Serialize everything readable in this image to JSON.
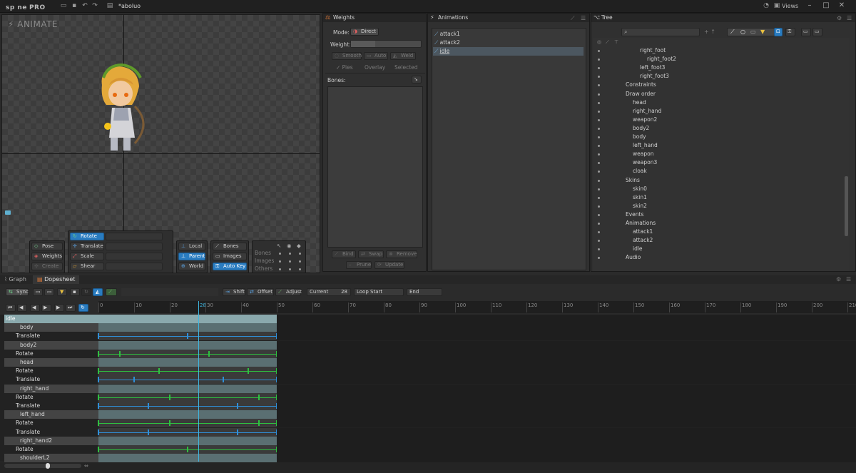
{
  "app": {
    "logo": "sp ne",
    "edition": "PRO",
    "project": "*aboluo",
    "views": "Views"
  },
  "viewport": {
    "mode_label": "ANIMATE"
  },
  "tools": {
    "pose": "Pose",
    "weights": "Weights",
    "create": "Create",
    "rotate": "Rotate",
    "translate": "Translate",
    "scale": "Scale",
    "shear": "Shear",
    "local": "Local",
    "parent": "Parent",
    "world": "World",
    "bones": "Bones",
    "images": "Images",
    "auto_key": "Auto Key",
    "vis_bones": "Bones",
    "vis_images": "Images",
    "vis_others": "Others"
  },
  "weights": {
    "title": "Weights",
    "mode_label": "Mode:",
    "mode_value": "Direct",
    "weight_label": "Weight:",
    "smooth": "Smooth",
    "auto": "Auto",
    "weld": "Weld",
    "pies": "Pies",
    "overlay": "Overlay",
    "selected": "Selected",
    "bones_label": "Bones:",
    "bind": "Bind",
    "swap": "Swap",
    "remove": "Remove",
    "prune": "Prune",
    "update": "Update"
  },
  "animations": {
    "title": "Animations",
    "items": [
      "attack1",
      "attack2",
      "idle"
    ]
  },
  "tree": {
    "title": "Tree",
    "rows": [
      {
        "label": "right_foot",
        "indent": 3
      },
      {
        "label": "right_foot2",
        "indent": 4
      },
      {
        "label": "left_foot3",
        "indent": 3
      },
      {
        "label": "right_foot3",
        "indent": 3
      },
      {
        "label": "Constraints",
        "indent": 1
      },
      {
        "label": "Draw order",
        "indent": 1
      },
      {
        "label": "head",
        "indent": 2
      },
      {
        "label": "right_hand",
        "indent": 2
      },
      {
        "label": "weapon2",
        "indent": 2
      },
      {
        "label": "body2",
        "indent": 2
      },
      {
        "label": "body",
        "indent": 2
      },
      {
        "label": "left_hand",
        "indent": 2
      },
      {
        "label": "weapon",
        "indent": 2
      },
      {
        "label": "weapon3",
        "indent": 2
      },
      {
        "label": "cloak",
        "indent": 2
      },
      {
        "label": "Skins",
        "indent": 1
      },
      {
        "label": "skin0",
        "indent": 2
      },
      {
        "label": "skin1",
        "indent": 2
      },
      {
        "label": "skin2",
        "indent": 2
      },
      {
        "label": "Events",
        "indent": 1
      },
      {
        "label": "Animations",
        "indent": 1
      },
      {
        "label": "attack1",
        "indent": 2
      },
      {
        "label": "attack2",
        "indent": 2
      },
      {
        "label": "idle",
        "indent": 2
      },
      {
        "label": "Audio",
        "indent": 1
      }
    ]
  },
  "dopesheet": {
    "tab_graph": "Graph",
    "tab_dopesheet": "Dopesheet",
    "sync": "Sync",
    "shift": "Shift",
    "offset": "Offset",
    "adjust": "Adjust",
    "current_label": "Current",
    "current_value": "28",
    "loop_start": "Loop Start",
    "end": "End",
    "ticks": [
      "0",
      "10",
      "20",
      "28",
      "30",
      "40",
      "50",
      "60",
      "70",
      "80",
      "90",
      "100",
      "110",
      "120",
      "130",
      "140",
      "150",
      "160",
      "170",
      "180",
      "190",
      "200",
      "210"
    ],
    "rows": [
      {
        "label": "idle",
        "kind": "anim"
      },
      {
        "label": "body",
        "kind": "bone"
      },
      {
        "label": "Translate",
        "kind": "tl",
        "color": "#2f8fd8",
        "keys": [
          0,
          25,
          50
        ]
      },
      {
        "label": "body2",
        "kind": "bone"
      },
      {
        "label": "Rotate",
        "kind": "tl",
        "color": "#2fc040",
        "keys": [
          0,
          6,
          31,
          50
        ]
      },
      {
        "label": "head",
        "kind": "bone"
      },
      {
        "label": "Rotate",
        "kind": "tl",
        "color": "#2fc040",
        "keys": [
          0,
          17,
          42,
          50
        ]
      },
      {
        "label": "Translate",
        "kind": "tl",
        "color": "#2f8fd8",
        "keys": [
          0,
          10,
          35,
          50
        ]
      },
      {
        "label": "right_hand",
        "kind": "bone"
      },
      {
        "label": "Rotate",
        "kind": "tl",
        "color": "#2fc040",
        "keys": [
          0,
          20,
          45,
          50
        ]
      },
      {
        "label": "Translate",
        "kind": "tl",
        "color": "#2f8fd8",
        "keys": [
          0,
          14,
          39,
          50
        ]
      },
      {
        "label": "left_hand",
        "kind": "bone"
      },
      {
        "label": "Rotate",
        "kind": "tl",
        "color": "#2fc040",
        "keys": [
          0,
          20,
          45,
          50
        ]
      },
      {
        "label": "Translate",
        "kind": "tl",
        "color": "#2f8fd8",
        "keys": [
          0,
          14,
          39,
          50
        ]
      },
      {
        "label": "right_hand2",
        "kind": "bone"
      },
      {
        "label": "Rotate",
        "kind": "tl",
        "color": "#2fc040",
        "keys": [
          0,
          25,
          50
        ]
      },
      {
        "label": "shoulderL2",
        "kind": "bone"
      }
    ]
  }
}
